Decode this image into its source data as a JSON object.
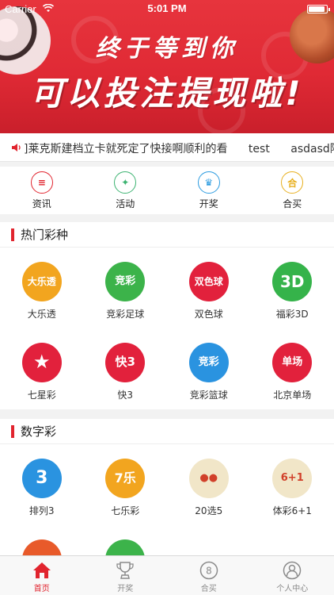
{
  "status_bar": {
    "carrier": "Carrier",
    "time": "5:01 PM"
  },
  "banner": {
    "line1": "终于等到你",
    "line2": "可以投注提现啦!"
  },
  "marquee": {
    "items": [
      "]莱克斯建档立卡就死定了快接啊顺利的看",
      "test",
      "asdasd阿"
    ]
  },
  "quick_nav": [
    {
      "label": "资讯",
      "icon": "news-icon",
      "color": "#e1242e",
      "glyph": "≡"
    },
    {
      "label": "活动",
      "icon": "activity-icon",
      "color": "#3cb371",
      "glyph": "✦"
    },
    {
      "label": "开奖",
      "icon": "trophy-icon",
      "color": "#2b9be0",
      "glyph": "♛"
    },
    {
      "label": "合买",
      "icon": "group-buy-icon",
      "color": "#e8b020",
      "glyph": "合"
    }
  ],
  "hot_section": {
    "title": "热门彩种",
    "items": [
      {
        "label": "大乐透",
        "icon": "dlt-icon",
        "color": "#f2a51f",
        "glyph": "大乐透"
      },
      {
        "label": "竞彩足球",
        "icon": "football-icon",
        "color": "#3cb34a",
        "glyph": "竞彩"
      },
      {
        "label": "双色球",
        "icon": "ssq-icon",
        "color": "#e2213c",
        "glyph": "双色球"
      },
      {
        "label": "福彩3D",
        "icon": "fc3d-icon",
        "color": "#35b34a",
        "glyph": "3D"
      },
      {
        "label": "七星彩",
        "icon": "qxc-icon",
        "color": "#e2213c",
        "glyph": "★"
      },
      {
        "label": "快3",
        "icon": "k3-icon",
        "color": "#e2213c",
        "glyph": "快3"
      },
      {
        "label": "竞彩篮球",
        "icon": "basketball-icon",
        "color": "#2a93e0",
        "glyph": "竞彩"
      },
      {
        "label": "北京单场",
        "icon": "bjdc-icon",
        "color": "#e2213c",
        "glyph": "单场"
      }
    ]
  },
  "digit_section": {
    "title": "数字彩",
    "items": [
      {
        "label": "排列3",
        "icon": "pl3-icon",
        "color": "#2a93e0",
        "glyph": "3"
      },
      {
        "label": "七乐彩",
        "icon": "qlc-icon",
        "color": "#f2a51f",
        "glyph": "7乐"
      },
      {
        "label": "20选5",
        "icon": "20x5-icon",
        "color": "#f1e6c8",
        "glyph": "●●"
      },
      {
        "label": "体彩6+1",
        "icon": "tc61-icon",
        "color": "#f1e6c8",
        "glyph": "6+1"
      },
      {
        "label": "",
        "icon": "more-lottery-icon",
        "color": "#e85a2a",
        "glyph": ""
      },
      {
        "label": "",
        "icon": "more-lottery-icon",
        "color": "#3cb34a",
        "glyph": ""
      }
    ]
  },
  "tab_bar": [
    {
      "label": "首页",
      "icon": "home-icon",
      "active": true
    },
    {
      "label": "开奖",
      "icon": "trophy-icon",
      "active": false
    },
    {
      "label": "合买",
      "icon": "group-buy-icon",
      "active": false
    },
    {
      "label": "个人中心",
      "icon": "user-icon",
      "active": false
    }
  ]
}
